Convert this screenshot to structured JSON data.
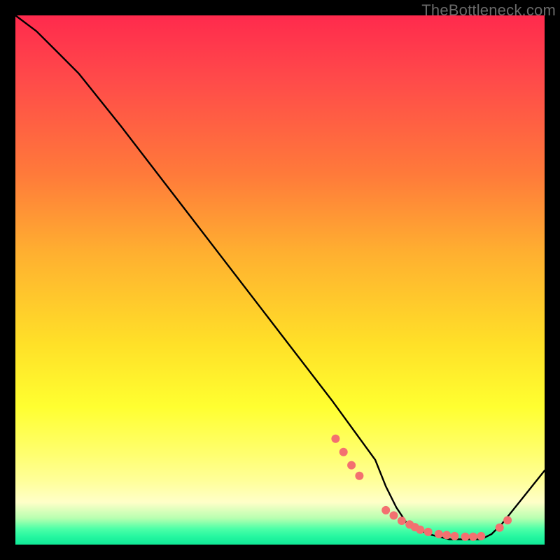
{
  "watermark": {
    "text": "TheBottleneck.com"
  },
  "chart_data": {
    "type": "line",
    "title": "",
    "xlabel": "",
    "ylabel": "",
    "xlim": [
      0,
      100
    ],
    "ylim": [
      0,
      100
    ],
    "grid": false,
    "legend": false,
    "background": "heat-gradient",
    "series": [
      {
        "name": "bottleneck-curve",
        "x": [
          0,
          4,
          8,
          12,
          20,
          30,
          40,
          50,
          60,
          68,
          70,
          72,
          74,
          78,
          82,
          86,
          88,
          90,
          92,
          96,
          100
        ],
        "y": [
          100,
          97,
          93,
          89,
          79,
          66,
          53,
          40,
          27,
          16,
          11,
          7,
          4,
          2,
          1,
          1,
          1,
          2,
          4,
          9,
          14
        ]
      }
    ],
    "markers": [
      {
        "name": "highlight-dots",
        "color": "#f37070",
        "x": [
          60.5,
          62,
          63.5,
          65,
          70,
          71.5,
          73,
          74.5,
          75.5,
          76.5,
          78,
          80,
          81.5,
          83,
          85,
          86.5,
          88,
          91.5,
          93
        ],
        "y": [
          20,
          17.5,
          15,
          13,
          6.5,
          5.5,
          4.5,
          3.8,
          3.3,
          2.8,
          2.4,
          2.0,
          1.8,
          1.6,
          1.5,
          1.5,
          1.6,
          3.2,
          4.6
        ]
      }
    ]
  }
}
